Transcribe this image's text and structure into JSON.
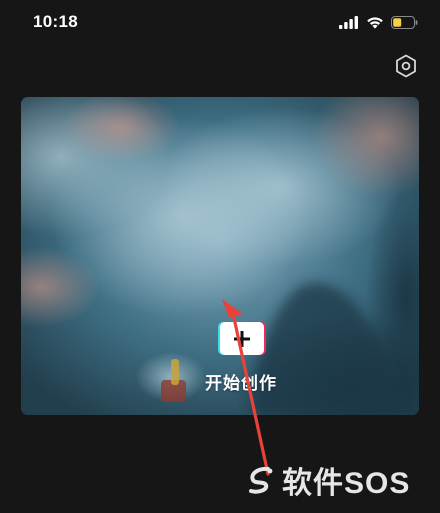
{
  "status_bar": {
    "time": "10:18"
  },
  "header": {
    "settings_icon": "gear-hexagon-icon"
  },
  "hero": {
    "create_label": "开始创作",
    "create_icon": "plus-icon",
    "accent_cyan": "#35e0e6",
    "accent_red": "#f02a58"
  },
  "annotation": {
    "arrow_color": "#e8423a"
  },
  "watermark": {
    "text": "软件SOS"
  }
}
